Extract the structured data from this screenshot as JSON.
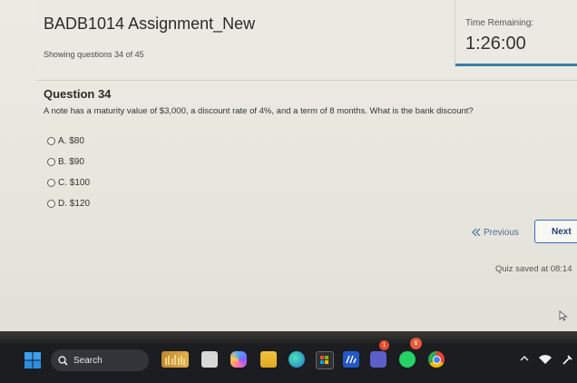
{
  "header": {
    "title": "BADB1014 Assignment_New",
    "showing": "Showing questions 34 of 45"
  },
  "timer": {
    "label": "Time Remaining:",
    "value": "1:26:00"
  },
  "question": {
    "heading": "Question 34",
    "text": "A note has a maturity value of $3,000, a discount rate of 4%, and a term of 8 months. What is the bank discount?",
    "options": [
      {
        "label": "A. $80"
      },
      {
        "label": "B. $90"
      },
      {
        "label": "C. $100"
      },
      {
        "label": "D. $120"
      }
    ]
  },
  "navigation": {
    "previous_label": "Previous",
    "next_label": "Next"
  },
  "status": {
    "saved": "Quiz saved at 08:14"
  },
  "taskbar": {
    "search_label": "Search",
    "notification_badge": "1",
    "chrome_badge": "6"
  },
  "colors": {
    "accent": "#3a7fa3",
    "next_border": "#3b6fb4",
    "link": "#4b6f9a",
    "taskbar": "#1c1d21"
  },
  "icons": [
    "windows-start-icon",
    "search-icon",
    "widgets-icon",
    "copilot-icon",
    "file-explorer-icon",
    "edge-icon",
    "store-icon",
    "app-icon",
    "teams-icon",
    "whatsapp-icon",
    "chrome-icon",
    "tray-chevron-icon",
    "wifi-icon",
    "pen-icon"
  ]
}
